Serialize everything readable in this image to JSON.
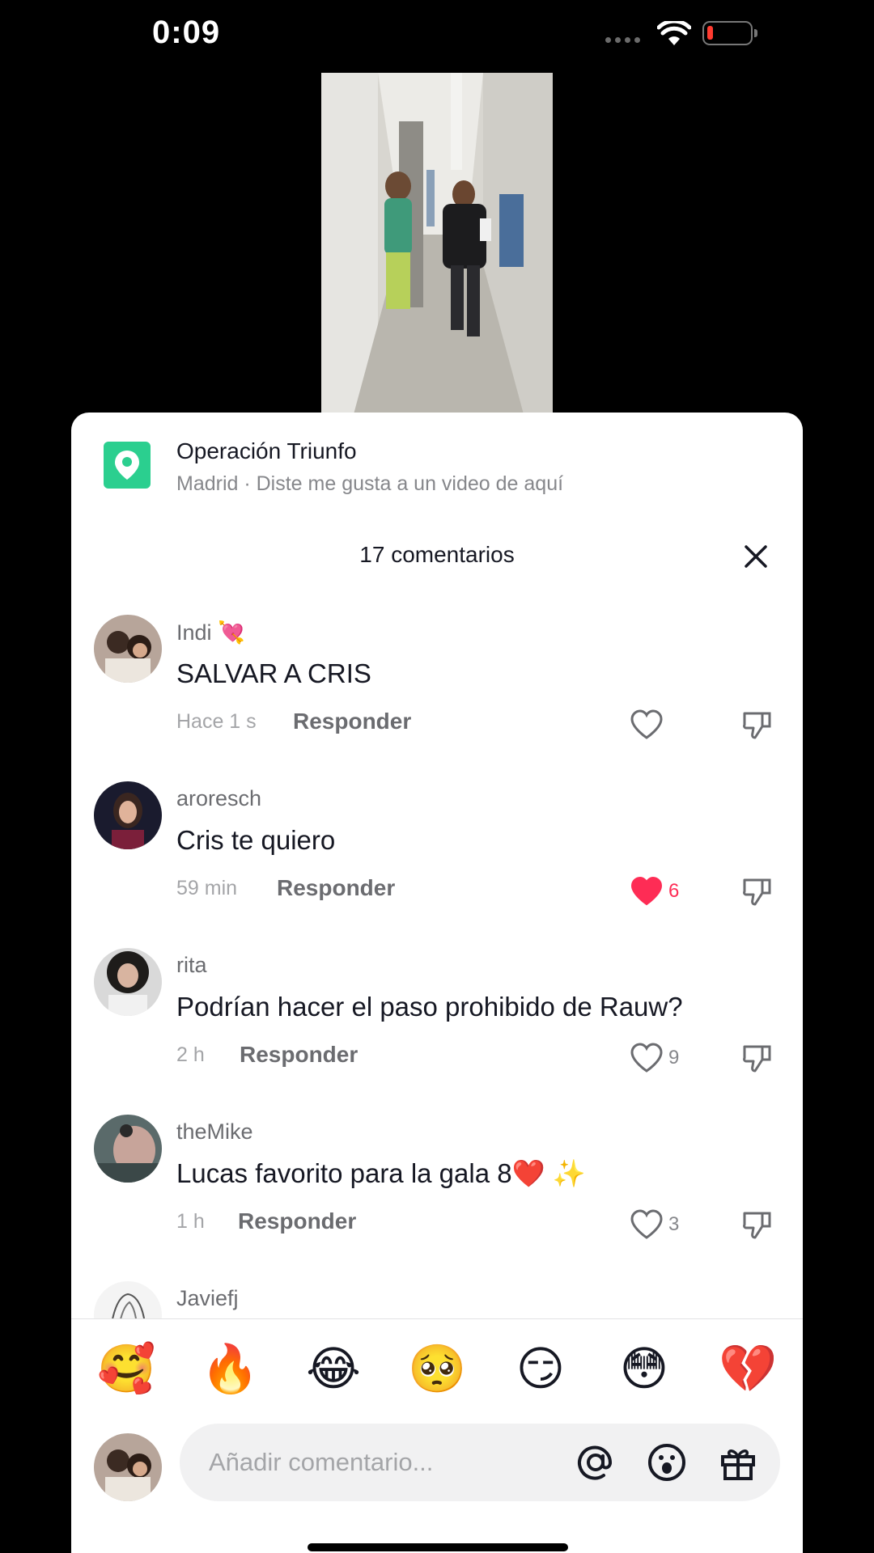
{
  "status_bar": {
    "time": "0:09"
  },
  "location": {
    "title": "Operación Triunfo",
    "subtitle": "Madrid · Diste me gusta a un video de aquí"
  },
  "comments_header": {
    "count_label": "17 comentarios"
  },
  "comments": [
    {
      "user": "Indi 💘",
      "text": "SALVAR A CRIS",
      "time": "Hace 1 s",
      "reply": "Responder",
      "likes": "",
      "liked": false
    },
    {
      "user": "aroresch",
      "text": "Cris te quiero",
      "time": "59 min",
      "reply": "Responder",
      "likes": "6",
      "liked": true
    },
    {
      "user": "rita",
      "text": "Podrían hacer el paso prohibido de Rauw?",
      "time": "2 h",
      "reply": "Responder",
      "likes": "9",
      "liked": false
    },
    {
      "user": "theMike",
      "text": "Lucas favorito para la gala 8❤️ ✨",
      "time": "1 h",
      "reply": "Responder",
      "likes": "3",
      "liked": false
    },
    {
      "user": "Javiefj",
      "text": "",
      "time": "",
      "reply": "",
      "likes": "",
      "liked": false
    }
  ],
  "quick_emojis": [
    "🥰",
    "🔥",
    "😂",
    "🥺",
    "😏",
    "😳",
    "💔"
  ],
  "composer": {
    "placeholder": "Añadir comentario..."
  },
  "colors": {
    "accent_pink": "#fe2c55",
    "location_green": "#2bcf8f",
    "battery_red": "#ff3b30"
  },
  "icons": [
    "location-pin-icon",
    "close-icon",
    "heart-icon",
    "dislike-icon",
    "mention-icon",
    "emoji-icon",
    "gift-icon",
    "wifi-icon",
    "battery-icon"
  ]
}
